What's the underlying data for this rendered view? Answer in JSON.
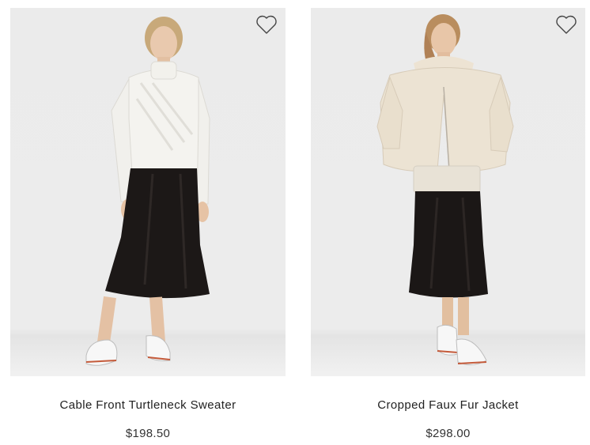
{
  "products": [
    {
      "name": "Cable Front Turtleneck Sweater",
      "price": "$198.50",
      "image_alt": "Model wearing white cable front turtleneck sweater with black satin midi skirt",
      "wishlist_icon": "heart-outline-icon"
    },
    {
      "name": "Cropped Faux Fur Jacket",
      "price": "$298.00",
      "image_alt": "Model wearing cream cropped faux fur jacket with black satin midi skirt",
      "wishlist_icon": "heart-outline-icon"
    }
  ],
  "colors": {
    "background": "#ffffff",
    "photo_backdrop": "#ebebeb",
    "text": "#222222"
  }
}
